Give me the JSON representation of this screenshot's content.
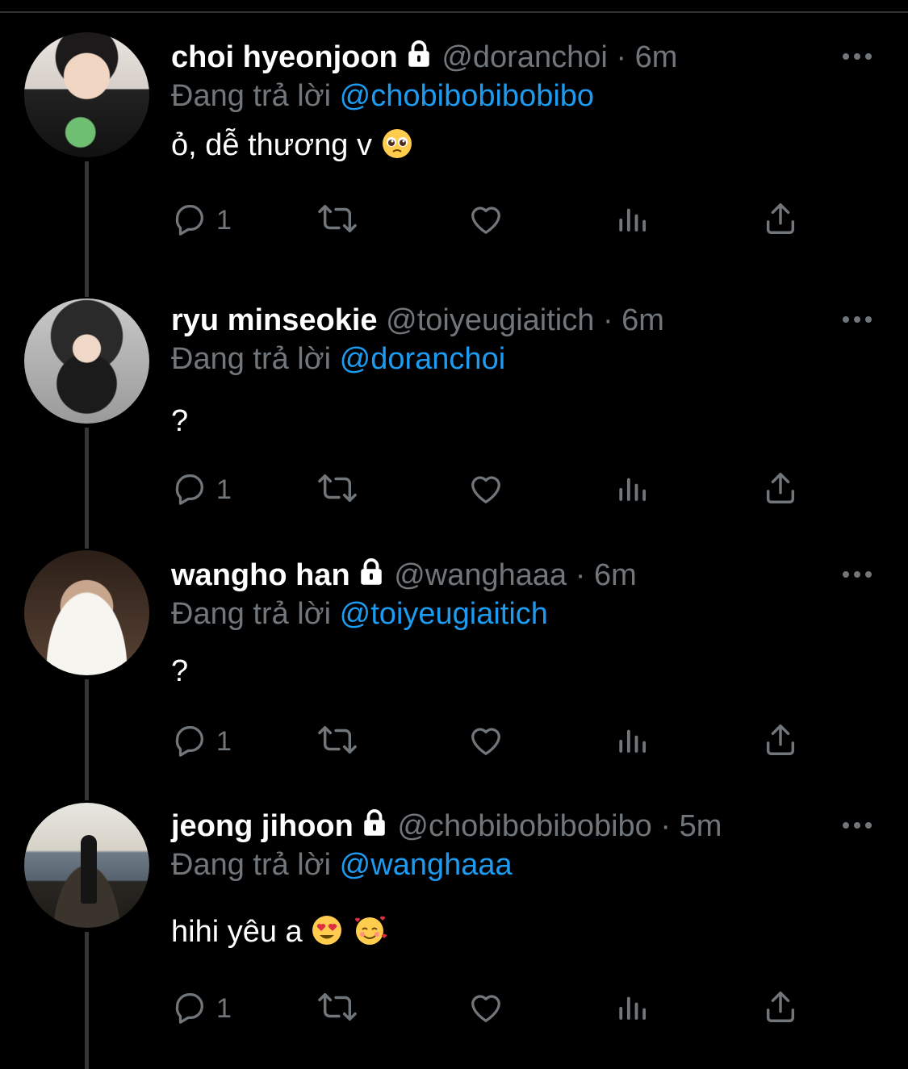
{
  "labels": {
    "replying_to": "Đang trả lời"
  },
  "colors": {
    "background": "#000000",
    "secondary_text": "#71767b",
    "link": "#1d9bf0",
    "thread_line": "#333639"
  },
  "icons": [
    "lock-icon",
    "more-icon",
    "reply-icon",
    "retweet-icon",
    "like-icon",
    "views-icon",
    "share-icon"
  ],
  "tweets": [
    {
      "name": "choi hyeonjoon",
      "protected": true,
      "handle": "@doranchoi",
      "sep": "·",
      "time": "6m",
      "reply_to": "@chobibobibobibo",
      "text": "ỏ, dễ thương v",
      "emojis": [
        "pleading-face-emoji"
      ],
      "replies": "1"
    },
    {
      "name": "ryu minseokie",
      "protected": false,
      "handle": "@toiyeugiaitich",
      "sep": "·",
      "time": "6m",
      "reply_to": "@doranchoi",
      "text": "?",
      "emojis": [],
      "replies": "1"
    },
    {
      "name": "wangho han",
      "protected": true,
      "handle": "@wanghaaa",
      "sep": "·",
      "time": "6m",
      "reply_to": "@toiyeugiaitich",
      "text": "?",
      "emojis": [],
      "replies": "1"
    },
    {
      "name": "jeong jihoon",
      "protected": true,
      "handle": "@chobibobibobibo",
      "sep": "·",
      "time": "5m",
      "reply_to": "@wanghaaa",
      "text": "hihi yêu a",
      "emojis": [
        "heart-eyes-emoji",
        "smiling-face-with-hearts-emoji"
      ],
      "replies": "1"
    }
  ]
}
